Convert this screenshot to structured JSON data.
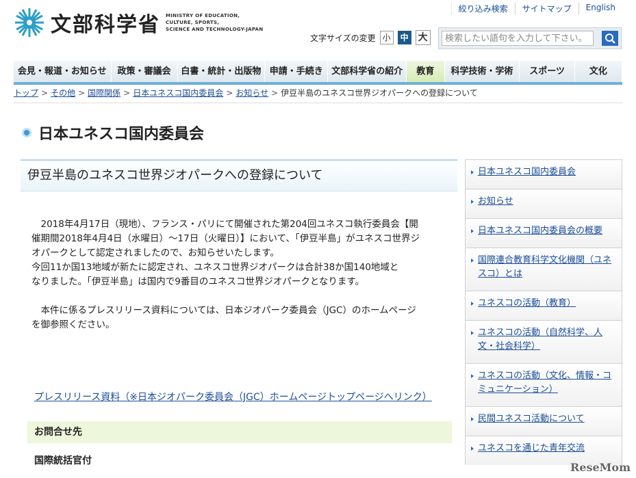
{
  "utility_nav": [
    "絞り込み検索",
    "サイトマップ",
    "English"
  ],
  "logo": {
    "title": "文部科学省",
    "en_line1": "MINISTRY OF EDUCATION,",
    "en_line2": "CULTURE, SPORTS,",
    "en_line3": "SCIENCE AND TECHNOLOGY-JAPAN"
  },
  "font_size": {
    "label": "文字サイズの変更",
    "small": "小",
    "medium": "中",
    "large": "大"
  },
  "search": {
    "placeholder": "検索したい語句を入力して下さい。"
  },
  "global_nav": [
    "会見・報道・お知らせ",
    "政策・審議会",
    "白書・統計・出版物",
    "申請・手続き",
    "文部科学省の紹介",
    "教育",
    "科学技術・学術",
    "スポーツ",
    "文化"
  ],
  "breadcrumb": [
    "トップ",
    "その他",
    "国際関係",
    "日本ユネスコ国内委員会",
    "お知らせ",
    "伊豆半島のユネスコ世界ジオパークへの登録について"
  ],
  "page_title": "日本ユネスコ国内委員会",
  "article": {
    "heading": "伊豆半島のユネスコ世界ジオパークへの登録について",
    "p1_line1": "　2018年4月17日（現地）、フランス・パリにて開催された第204回ユネスコ執行委員会【開",
    "p1_line2": "催期間2018年4月4日（水曜日）～17日（火曜日）】において、「伊豆半島」がユネスコ世界ジ",
    "p1_line3": "オパークとして認定されましたので、お知らせいたします。",
    "p2_line1": "今回11か国13地域が新たに認定され、ユネスコ世界ジオパークは合計38か国140地域と",
    "p2_line2": "なりました。「伊豆半島」は国内で9番目のユネスコ世界ジオパークとなります。",
    "p3_line1": "　本件に係るプレスリリース資料については、日本ジオパーク委員会（JGC）のホームページ",
    "p3_line2": "を御参照ください。",
    "link": "プレスリリース資料（※日本ジオパーク委員会（JGC）ホームページトップページへリンク）",
    "contact_heading": "お問合せ先",
    "contact_body": "国際統括官付"
  },
  "sidebar": [
    "日本ユネスコ国内委員会",
    "お知らせ",
    "日本ユネスコ国内委員会の概要",
    "国際連合教育科学文化機関（ユネスコ）とは",
    "ユネスコの活動（教育）",
    "ユネスコの活動（自然科学、人文・社会科学）",
    "ユネスコの活動（文化、情報・コミュニケーション）",
    "民間ユネスコ活動について",
    "ユネスコを通じた青年交流"
  ],
  "watermark": "ReseMom",
  "colors": {
    "accent": "#2a6ac0",
    "nav_border": "#6bb0d8",
    "education_nav": "#d7ebb6",
    "contact_bg": "#eef7dc"
  }
}
